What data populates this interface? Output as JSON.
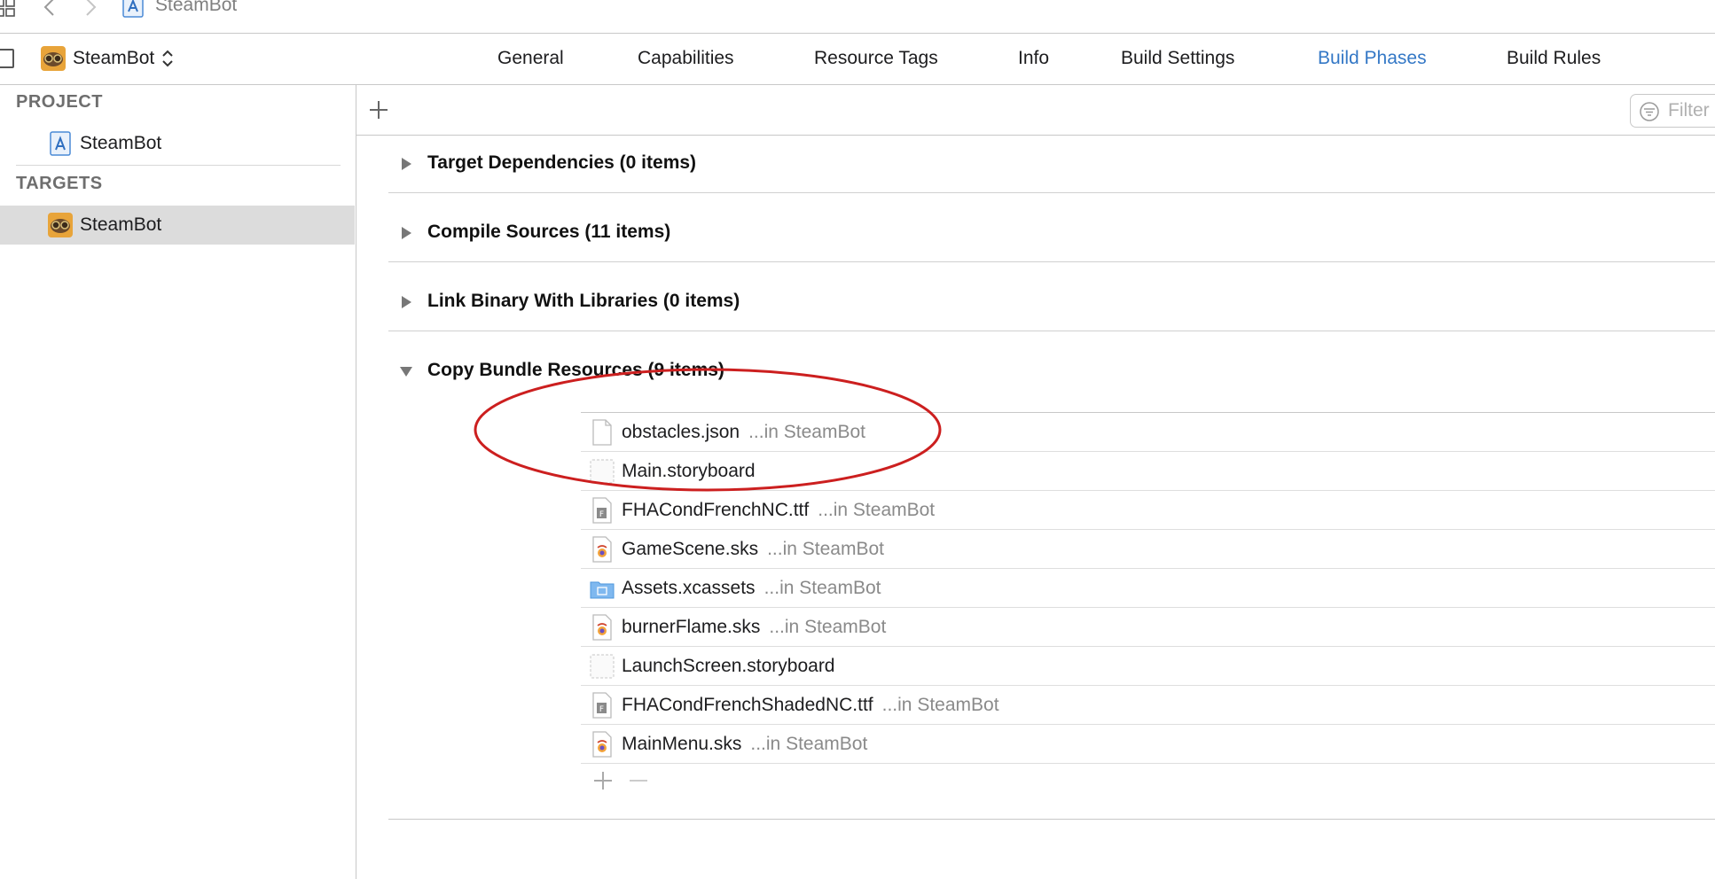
{
  "jumpbar": {
    "breadcrumb": "SteamBot"
  },
  "target_selector": {
    "label": "SteamBot"
  },
  "tabs": [
    {
      "label": "General"
    },
    {
      "label": "Capabilities"
    },
    {
      "label": "Resource Tags"
    },
    {
      "label": "Info"
    },
    {
      "label": "Build Settings"
    },
    {
      "label": "Build Phases"
    },
    {
      "label": "Build Rules"
    }
  ],
  "active_tab": "Build Phases",
  "sidebar": {
    "project_header": "PROJECT",
    "project_item": "SteamBot",
    "targets_header": "TARGETS",
    "target_item": "SteamBot"
  },
  "toolbar": {
    "filter_placeholder": "Filter"
  },
  "phases": [
    {
      "title": "Target Dependencies (0 items)",
      "expanded": false
    },
    {
      "title": "Compile Sources (11 items)",
      "expanded": false
    },
    {
      "title": "Link Binary With Libraries (0 items)",
      "expanded": false
    },
    {
      "title": "Copy Bundle Resources (9 items)",
      "expanded": true
    }
  ],
  "files": [
    {
      "name": "obstacles.json",
      "location": "...in SteamBot",
      "icon": "json-file-icon"
    },
    {
      "name": "Main.storyboard",
      "location": "",
      "icon": "storyboard-file-icon"
    },
    {
      "name": "FHACondFrenchNC.ttf",
      "location": "...in SteamBot",
      "icon": "font-file-icon"
    },
    {
      "name": "GameScene.sks",
      "location": "...in SteamBot",
      "icon": "sks-file-icon"
    },
    {
      "name": "Assets.xcassets",
      "location": "...in SteamBot",
      "icon": "folder-icon"
    },
    {
      "name": "burnerFlame.sks",
      "location": "...in SteamBot",
      "icon": "sks-file-icon"
    },
    {
      "name": "LaunchScreen.storyboard",
      "location": "",
      "icon": "storyboard-file-icon"
    },
    {
      "name": "FHACondFrenchShadedNC.ttf",
      "location": "...in SteamBot",
      "icon": "font-file-icon"
    },
    {
      "name": "MainMenu.sks",
      "location": "...in SteamBot",
      "icon": "sks-file-icon"
    }
  ],
  "colors": {
    "accent": "#3478c6",
    "annotation": "#cc1f1f"
  }
}
